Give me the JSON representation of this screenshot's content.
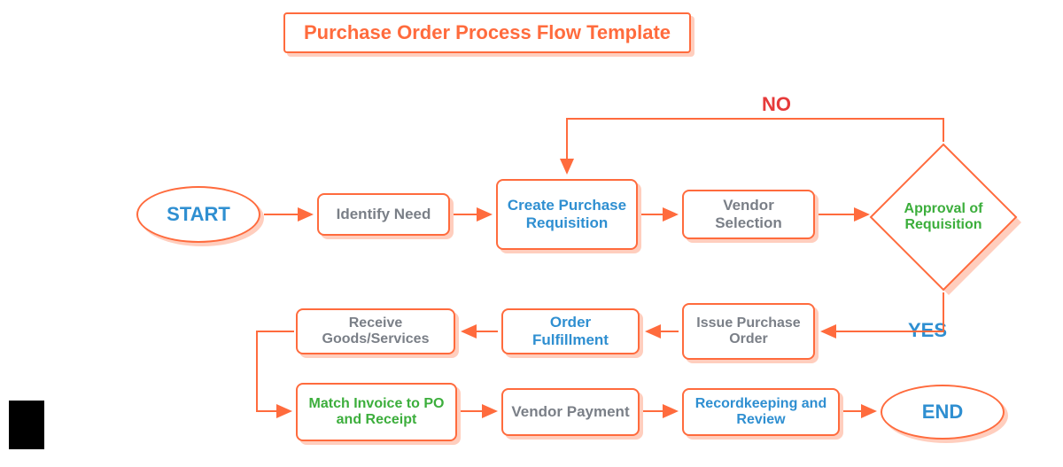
{
  "title": "Purchase Order Process Flow Template",
  "steps": {
    "start": "START",
    "identify": "Identify Need",
    "create": "Create Purchase Requisition",
    "vendor_sel": "Vendor Selection",
    "approval": "Approval of Requisition",
    "issue": "Issue Purchase Order",
    "fulfill": "Order Fulfillment",
    "receive": "Receive Goods/Services",
    "match": "Match Invoice to PO and Receipt",
    "payment": "Vendor Payment",
    "record": "Recordkeeping and Review",
    "end": "END"
  },
  "decision": {
    "no": "NO",
    "yes": "YES"
  },
  "colors": {
    "orange": "#ff6b3d",
    "blue": "#2f8fd1",
    "green": "#3cae3c",
    "grey": "#7a7f87",
    "red": "#e63a3a"
  }
}
